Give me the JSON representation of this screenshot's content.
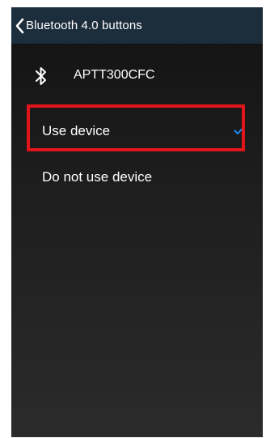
{
  "header": {
    "back_icon": "chevron-left-icon",
    "title": "Bluetooth 4.0 buttons"
  },
  "device": {
    "icon": "bluetooth-icon",
    "name": "APTT300CFC"
  },
  "options": [
    {
      "label": "Use device",
      "selected": true
    },
    {
      "label": "Do not use device",
      "selected": false
    }
  ],
  "colors": {
    "nav_bar": "#1c2d3c",
    "checkmark": "#1e8cf0",
    "highlight": "#e0141b",
    "text": "#ffffff"
  }
}
